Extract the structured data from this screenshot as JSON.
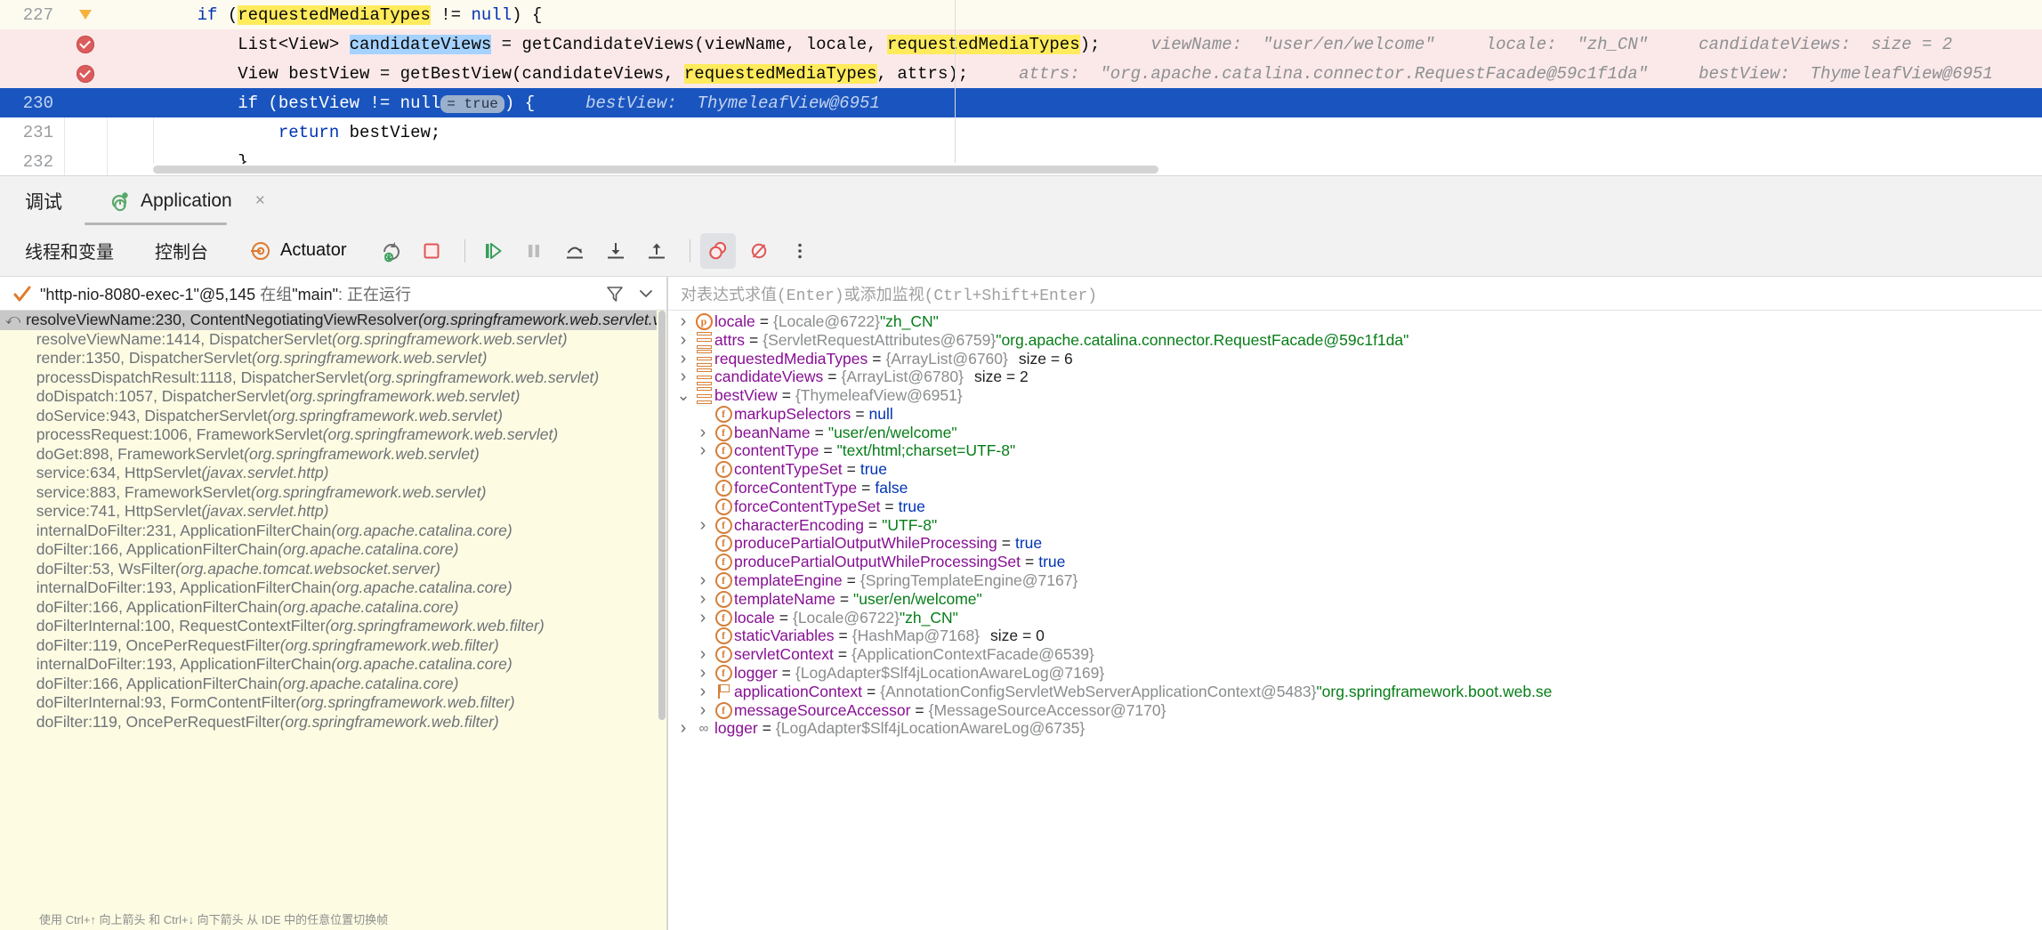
{
  "editor": {
    "lines": [
      {
        "num": "227",
        "gutter": "bulb-icon",
        "state": "warn",
        "segments": [
          {
            "t": "    ",
            "c": "plain"
          },
          {
            "t": "if",
            "c": "kw"
          },
          {
            "t": " (",
            "c": "plain"
          },
          {
            "t": "requestedMediaTypes",
            "c": "plain",
            "hl": "yellow"
          },
          {
            "t": " != ",
            "c": "plain"
          },
          {
            "t": "null",
            "c": "kw"
          },
          {
            "t": ") {",
            "c": "plain"
          }
        ],
        "hints": []
      },
      {
        "num": "",
        "gutter": "breakpoint-icon",
        "state": "bp",
        "segments": [
          {
            "t": "        ",
            "c": "plain"
          },
          {
            "t": "List<View> ",
            "c": "plain"
          },
          {
            "t": "candidateViews",
            "c": "plain",
            "hl": "blue"
          },
          {
            "t": " = getCandidateViews(viewName, locale, ",
            "c": "plain"
          },
          {
            "t": "requestedMediaTypes",
            "c": "plain",
            "hl": "yellow"
          },
          {
            "t": ");",
            "c": "plain"
          }
        ],
        "hints": [
          "viewName:  \"user/en/welcome\"",
          "locale:  \"zh_CN\"",
          "candidateViews:  size = 2"
        ]
      },
      {
        "num": "",
        "gutter": "breakpoint-icon",
        "state": "bp",
        "segments": [
          {
            "t": "        ",
            "c": "plain"
          },
          {
            "t": "View bestView = getBestView(candidateViews, ",
            "c": "plain"
          },
          {
            "t": "requestedMediaTypes",
            "c": "plain",
            "hl": "yellow"
          },
          {
            "t": ", attrs);",
            "c": "plain"
          }
        ],
        "hints": [
          "attrs:  \"org.apache.catalina.connector.RequestFacade@59c1f1da\"",
          "bestView:  ThymeleafView@6951"
        ]
      },
      {
        "num": "230",
        "gutter": "",
        "state": "exec",
        "segments": [
          {
            "t": "        ",
            "c": "plain"
          },
          {
            "t": "if",
            "c": "kw"
          },
          {
            "t": " (bestView != ",
            "c": "plain"
          },
          {
            "t": "null",
            "c": "plain"
          },
          {
            "t": "__CHIP__",
            "c": "chip",
            "chip": "= true"
          },
          {
            "t": ") {",
            "c": "plain"
          }
        ],
        "hints": [
          "bestView:  ThymeleafView@6951"
        ]
      },
      {
        "num": "231",
        "gutter": "",
        "state": "",
        "segments": [
          {
            "t": "            ",
            "c": "plain"
          },
          {
            "t": "return",
            "c": "kw"
          },
          {
            "t": " bestView;",
            "c": "plain"
          }
        ],
        "hints": []
      },
      {
        "num": "232",
        "gutter": "",
        "state": "",
        "segments": [
          {
            "t": "        }",
            "c": "plain"
          }
        ],
        "hints": []
      }
    ]
  },
  "tabstrip": {
    "title": "调试",
    "run_tab_label": "Application",
    "close_label": "×"
  },
  "toolbar": {
    "tab_threads_vars": "线程和变量",
    "tab_console": "控制台",
    "tab_actuator": "Actuator",
    "buttons": [
      "rerun-debug-button",
      "stop-button",
      "resume-button",
      "pause-button",
      "step-over-button",
      "step-into-button",
      "step-out-button",
      "view-breakpoints-button",
      "mute-breakpoints-button",
      "more-options-button"
    ]
  },
  "threads": {
    "header_text": "\"http-nio-8080-exec-1\"@5,145 ",
    "header_dim_1": "在组",
    "header_text_2": "\"main\"",
    "header_dim_2": ": 正在运行",
    "frames": [
      {
        "method": "resolveViewName:230, ContentNegotiatingViewResolver",
        "pkg": "(org.springframework.web.servlet.view)",
        "selected": true
      },
      {
        "method": "resolveViewName:1414, DispatcherServlet",
        "pkg": "(org.springframework.web.servlet)",
        "selected": false
      },
      {
        "method": "render:1350, DispatcherServlet",
        "pkg": "(org.springframework.web.servlet)",
        "selected": false
      },
      {
        "method": "processDispatchResult:1118, DispatcherServlet",
        "pkg": "(org.springframework.web.servlet)",
        "selected": false
      },
      {
        "method": "doDispatch:1057, DispatcherServlet",
        "pkg": "(org.springframework.web.servlet)",
        "selected": false
      },
      {
        "method": "doService:943, DispatcherServlet",
        "pkg": "(org.springframework.web.servlet)",
        "selected": false
      },
      {
        "method": "processRequest:1006, FrameworkServlet",
        "pkg": "(org.springframework.web.servlet)",
        "selected": false
      },
      {
        "method": "doGet:898, FrameworkServlet",
        "pkg": "(org.springframework.web.servlet)",
        "selected": false
      },
      {
        "method": "service:634, HttpServlet",
        "pkg": "(javax.servlet.http)",
        "selected": false
      },
      {
        "method": "service:883, FrameworkServlet",
        "pkg": "(org.springframework.web.servlet)",
        "selected": false
      },
      {
        "method": "service:741, HttpServlet",
        "pkg": "(javax.servlet.http)",
        "selected": false
      },
      {
        "method": "internalDoFilter:231, ApplicationFilterChain",
        "pkg": "(org.apache.catalina.core)",
        "selected": false
      },
      {
        "method": "doFilter:166, ApplicationFilterChain",
        "pkg": "(org.apache.catalina.core)",
        "selected": false
      },
      {
        "method": "doFilter:53, WsFilter",
        "pkg": "(org.apache.tomcat.websocket.server)",
        "selected": false
      },
      {
        "method": "internalDoFilter:193, ApplicationFilterChain",
        "pkg": "(org.apache.catalina.core)",
        "selected": false
      },
      {
        "method": "doFilter:166, ApplicationFilterChain",
        "pkg": "(org.apache.catalina.core)",
        "selected": false
      },
      {
        "method": "doFilterInternal:100, RequestContextFilter",
        "pkg": "(org.springframework.web.filter)",
        "selected": false
      },
      {
        "method": "doFilter:119, OncePerRequestFilter",
        "pkg": "(org.springframework.web.filter)",
        "selected": false
      },
      {
        "method": "internalDoFilter:193, ApplicationFilterChain",
        "pkg": "(org.apache.catalina.core)",
        "selected": false
      },
      {
        "method": "doFilter:166, ApplicationFilterChain",
        "pkg": "(org.apache.catalina.core)",
        "selected": false
      },
      {
        "method": "doFilterInternal:93, FormContentFilter",
        "pkg": "(org.springframework.web.filter)",
        "selected": false
      },
      {
        "method": "doFilter:119, OncePerRequestFilter",
        "pkg": "(org.springframework.web.filter)",
        "selected": false
      }
    ],
    "footer_hint": "使用 Ctrl+↑ 向上箭头 和 Ctrl+↓ 向下箭头 从 IDE 中的任意位置切换帧"
  },
  "watch": {
    "placeholder": "对表达式求值(Enter)或添加监视(Ctrl+Shift+Enter)"
  },
  "variables": [
    {
      "indent": 0,
      "twisty": ">",
      "icon": "p",
      "name": "locale",
      "eq": "=",
      "obj": "{Locale@6722}",
      "str": "\"zh_CN\"",
      "size": ""
    },
    {
      "indent": 0,
      "twisty": ">",
      "icon": "list",
      "name": "attrs",
      "eq": "=",
      "obj": "{ServletRequestAttributes@6759}",
      "str": "\"org.apache.catalina.connector.RequestFacade@59c1f1da\"",
      "size": ""
    },
    {
      "indent": 0,
      "twisty": ">",
      "icon": "list",
      "name": "requestedMediaTypes",
      "eq": "=",
      "obj": "{ArrayList@6760}",
      "str": "",
      "size": "size = 6"
    },
    {
      "indent": 0,
      "twisty": ">",
      "icon": "list",
      "name": "candidateViews",
      "eq": "=",
      "obj": "{ArrayList@6780}",
      "str": "",
      "size": "size = 2"
    },
    {
      "indent": 0,
      "twisty": "v",
      "icon": "list",
      "name": "bestView",
      "eq": "=",
      "obj": "{ThymeleafView@6951}",
      "str": "",
      "size": ""
    },
    {
      "indent": 1,
      "twisty": "",
      "icon": "f",
      "name": "markupSelectors",
      "eq": "=",
      "obj": "",
      "kw": "null",
      "str": "",
      "size": ""
    },
    {
      "indent": 1,
      "twisty": ">",
      "icon": "f",
      "name": "beanName",
      "eq": "=",
      "obj": "",
      "str": "\"user/en/welcome\"",
      "size": ""
    },
    {
      "indent": 1,
      "twisty": ">",
      "icon": "f",
      "name": "contentType",
      "eq": "=",
      "obj": "",
      "str": "\"text/html;charset=UTF-8\"",
      "size": ""
    },
    {
      "indent": 1,
      "twisty": "",
      "icon": "f",
      "name": "contentTypeSet",
      "eq": "=",
      "obj": "",
      "kw": "true",
      "str": "",
      "size": ""
    },
    {
      "indent": 1,
      "twisty": "",
      "icon": "f",
      "name": "forceContentType",
      "eq": "=",
      "obj": "",
      "kw": "false",
      "str": "",
      "size": ""
    },
    {
      "indent": 1,
      "twisty": "",
      "icon": "f",
      "name": "forceContentTypeSet",
      "eq": "=",
      "obj": "",
      "kw": "true",
      "str": "",
      "size": ""
    },
    {
      "indent": 1,
      "twisty": ">",
      "icon": "f",
      "name": "characterEncoding",
      "eq": "=",
      "obj": "",
      "str": "\"UTF-8\"",
      "size": ""
    },
    {
      "indent": 1,
      "twisty": "",
      "icon": "f",
      "name": "producePartialOutputWhileProcessing",
      "eq": "=",
      "obj": "",
      "kw": "true",
      "str": "",
      "size": ""
    },
    {
      "indent": 1,
      "twisty": "",
      "icon": "f",
      "name": "producePartialOutputWhileProcessingSet",
      "eq": "=",
      "obj": "",
      "kw": "true",
      "str": "",
      "size": ""
    },
    {
      "indent": 1,
      "twisty": ">",
      "icon": "f",
      "name": "templateEngine",
      "eq": "=",
      "obj": "{SpringTemplateEngine@7167}",
      "str": "",
      "size": ""
    },
    {
      "indent": 1,
      "twisty": ">",
      "icon": "f",
      "name": "templateName",
      "eq": "=",
      "obj": "",
      "str": "\"user/en/welcome\"",
      "size": ""
    },
    {
      "indent": 1,
      "twisty": ">",
      "icon": "f",
      "name": "locale",
      "eq": "=",
      "obj": "{Locale@6722}",
      "str": "\"zh_CN\"",
      "size": ""
    },
    {
      "indent": 1,
      "twisty": "",
      "icon": "f",
      "name": "staticVariables",
      "eq": "=",
      "obj": "{HashMap@7168}",
      "str": "",
      "size": "size = 0"
    },
    {
      "indent": 1,
      "twisty": ">",
      "icon": "f",
      "name": "servletContext",
      "eq": "=",
      "obj": "{ApplicationContextFacade@6539}",
      "str": "",
      "size": ""
    },
    {
      "indent": 1,
      "twisty": ">",
      "icon": "f",
      "name": "logger",
      "eq": "=",
      "obj": "{LogAdapter$Slf4jLocationAwareLog@7169}",
      "str": "",
      "size": ""
    },
    {
      "indent": 1,
      "twisty": ">",
      "icon": "flag",
      "name": "applicationContext",
      "eq": "=",
      "obj": "{AnnotationConfigServletWebServerApplicationContext@5483}",
      "str": "\"org.springframework.boot.web.se",
      "size": ""
    },
    {
      "indent": 1,
      "twisty": ">",
      "icon": "f",
      "name": "messageSourceAccessor",
      "eq": "=",
      "obj": "{MessageSourceAccessor@7170}",
      "str": "",
      "size": ""
    },
    {
      "indent": 0,
      "twisty": ">",
      "icon": "link",
      "name": "logger",
      "eq": "=",
      "obj": "{LogAdapter$Slf4jLocationAwareLog@6735}",
      "str": "",
      "size": ""
    }
  ],
  "colors": {
    "exec_line": "#1a55bf",
    "breakpoint_line": "#fbe9e9",
    "highlight_yellow": "#ffeb5c",
    "highlight_blue": "#a6d2ff",
    "frames_bg": "#fdfce3",
    "selected_frame": "#c8c8c8",
    "accent_orange": "#d4803a",
    "string_green": "#067d17",
    "name_purple": "#871094"
  }
}
